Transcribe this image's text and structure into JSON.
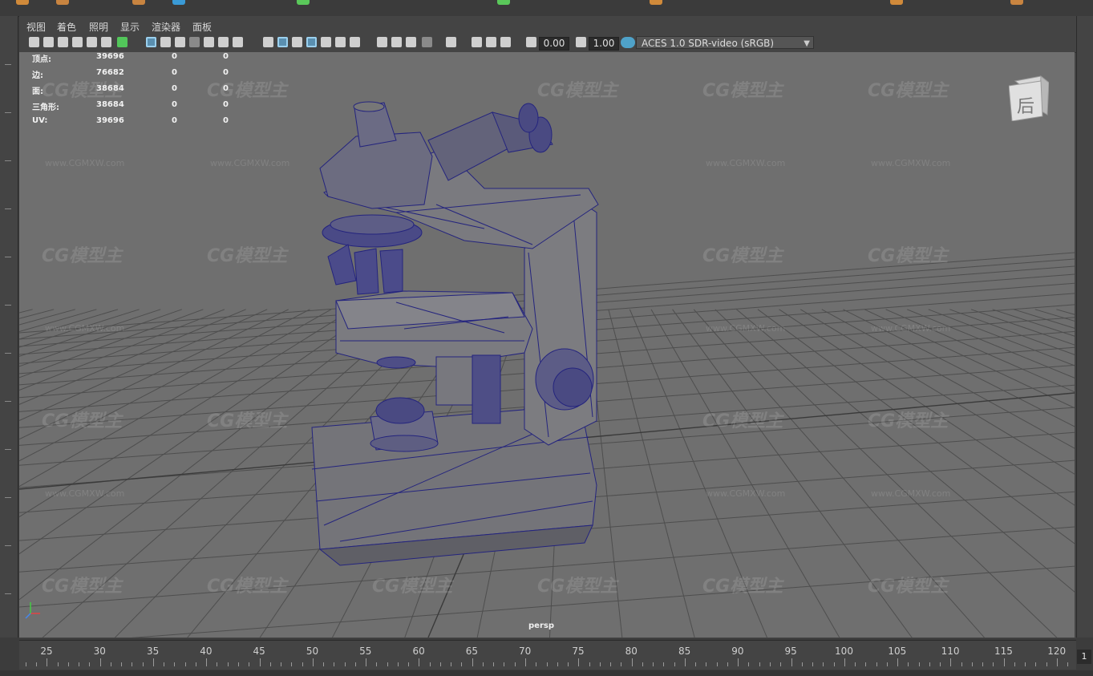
{
  "menu": [
    "视图",
    "着色",
    "照明",
    "显示",
    "渲染器",
    "面板"
  ],
  "toolbar": {
    "exposure_value": "0.00",
    "gamma_value": "1.00",
    "color_space": "ACES 1.0 SDR-video (sRGB)"
  },
  "hud": {
    "rows": [
      {
        "label": "顶点:",
        "v1": "39696",
        "v2": "0",
        "v3": "0"
      },
      {
        "label": "边:",
        "v1": "76682",
        "v2": "0",
        "v3": "0"
      },
      {
        "label": "面:",
        "v1": "38684",
        "v2": "0",
        "v3": "0"
      },
      {
        "label": "三角形:",
        "v1": "38684",
        "v2": "0",
        "v3": "0"
      },
      {
        "label": "UV:",
        "v1": "39696",
        "v2": "0",
        "v3": "0"
      }
    ]
  },
  "viewcube_label": "后",
  "camera_label": "persp",
  "watermark": {
    "logo": "CG模型主",
    "url": "www.CGMXW.com"
  },
  "timeline": {
    "ticks": [
      "25",
      "30",
      "35",
      "40",
      "45",
      "50",
      "55",
      "60",
      "65",
      "70",
      "75",
      "80",
      "85",
      "90",
      "95",
      "100",
      "105",
      "110",
      "115",
      "120"
    ],
    "current_frame": "1"
  },
  "colors": {
    "viewport_bg": "#6f6f6f",
    "wire": "#22227a",
    "grid": "#4a4a4a",
    "accent": "#4fa2c9"
  }
}
